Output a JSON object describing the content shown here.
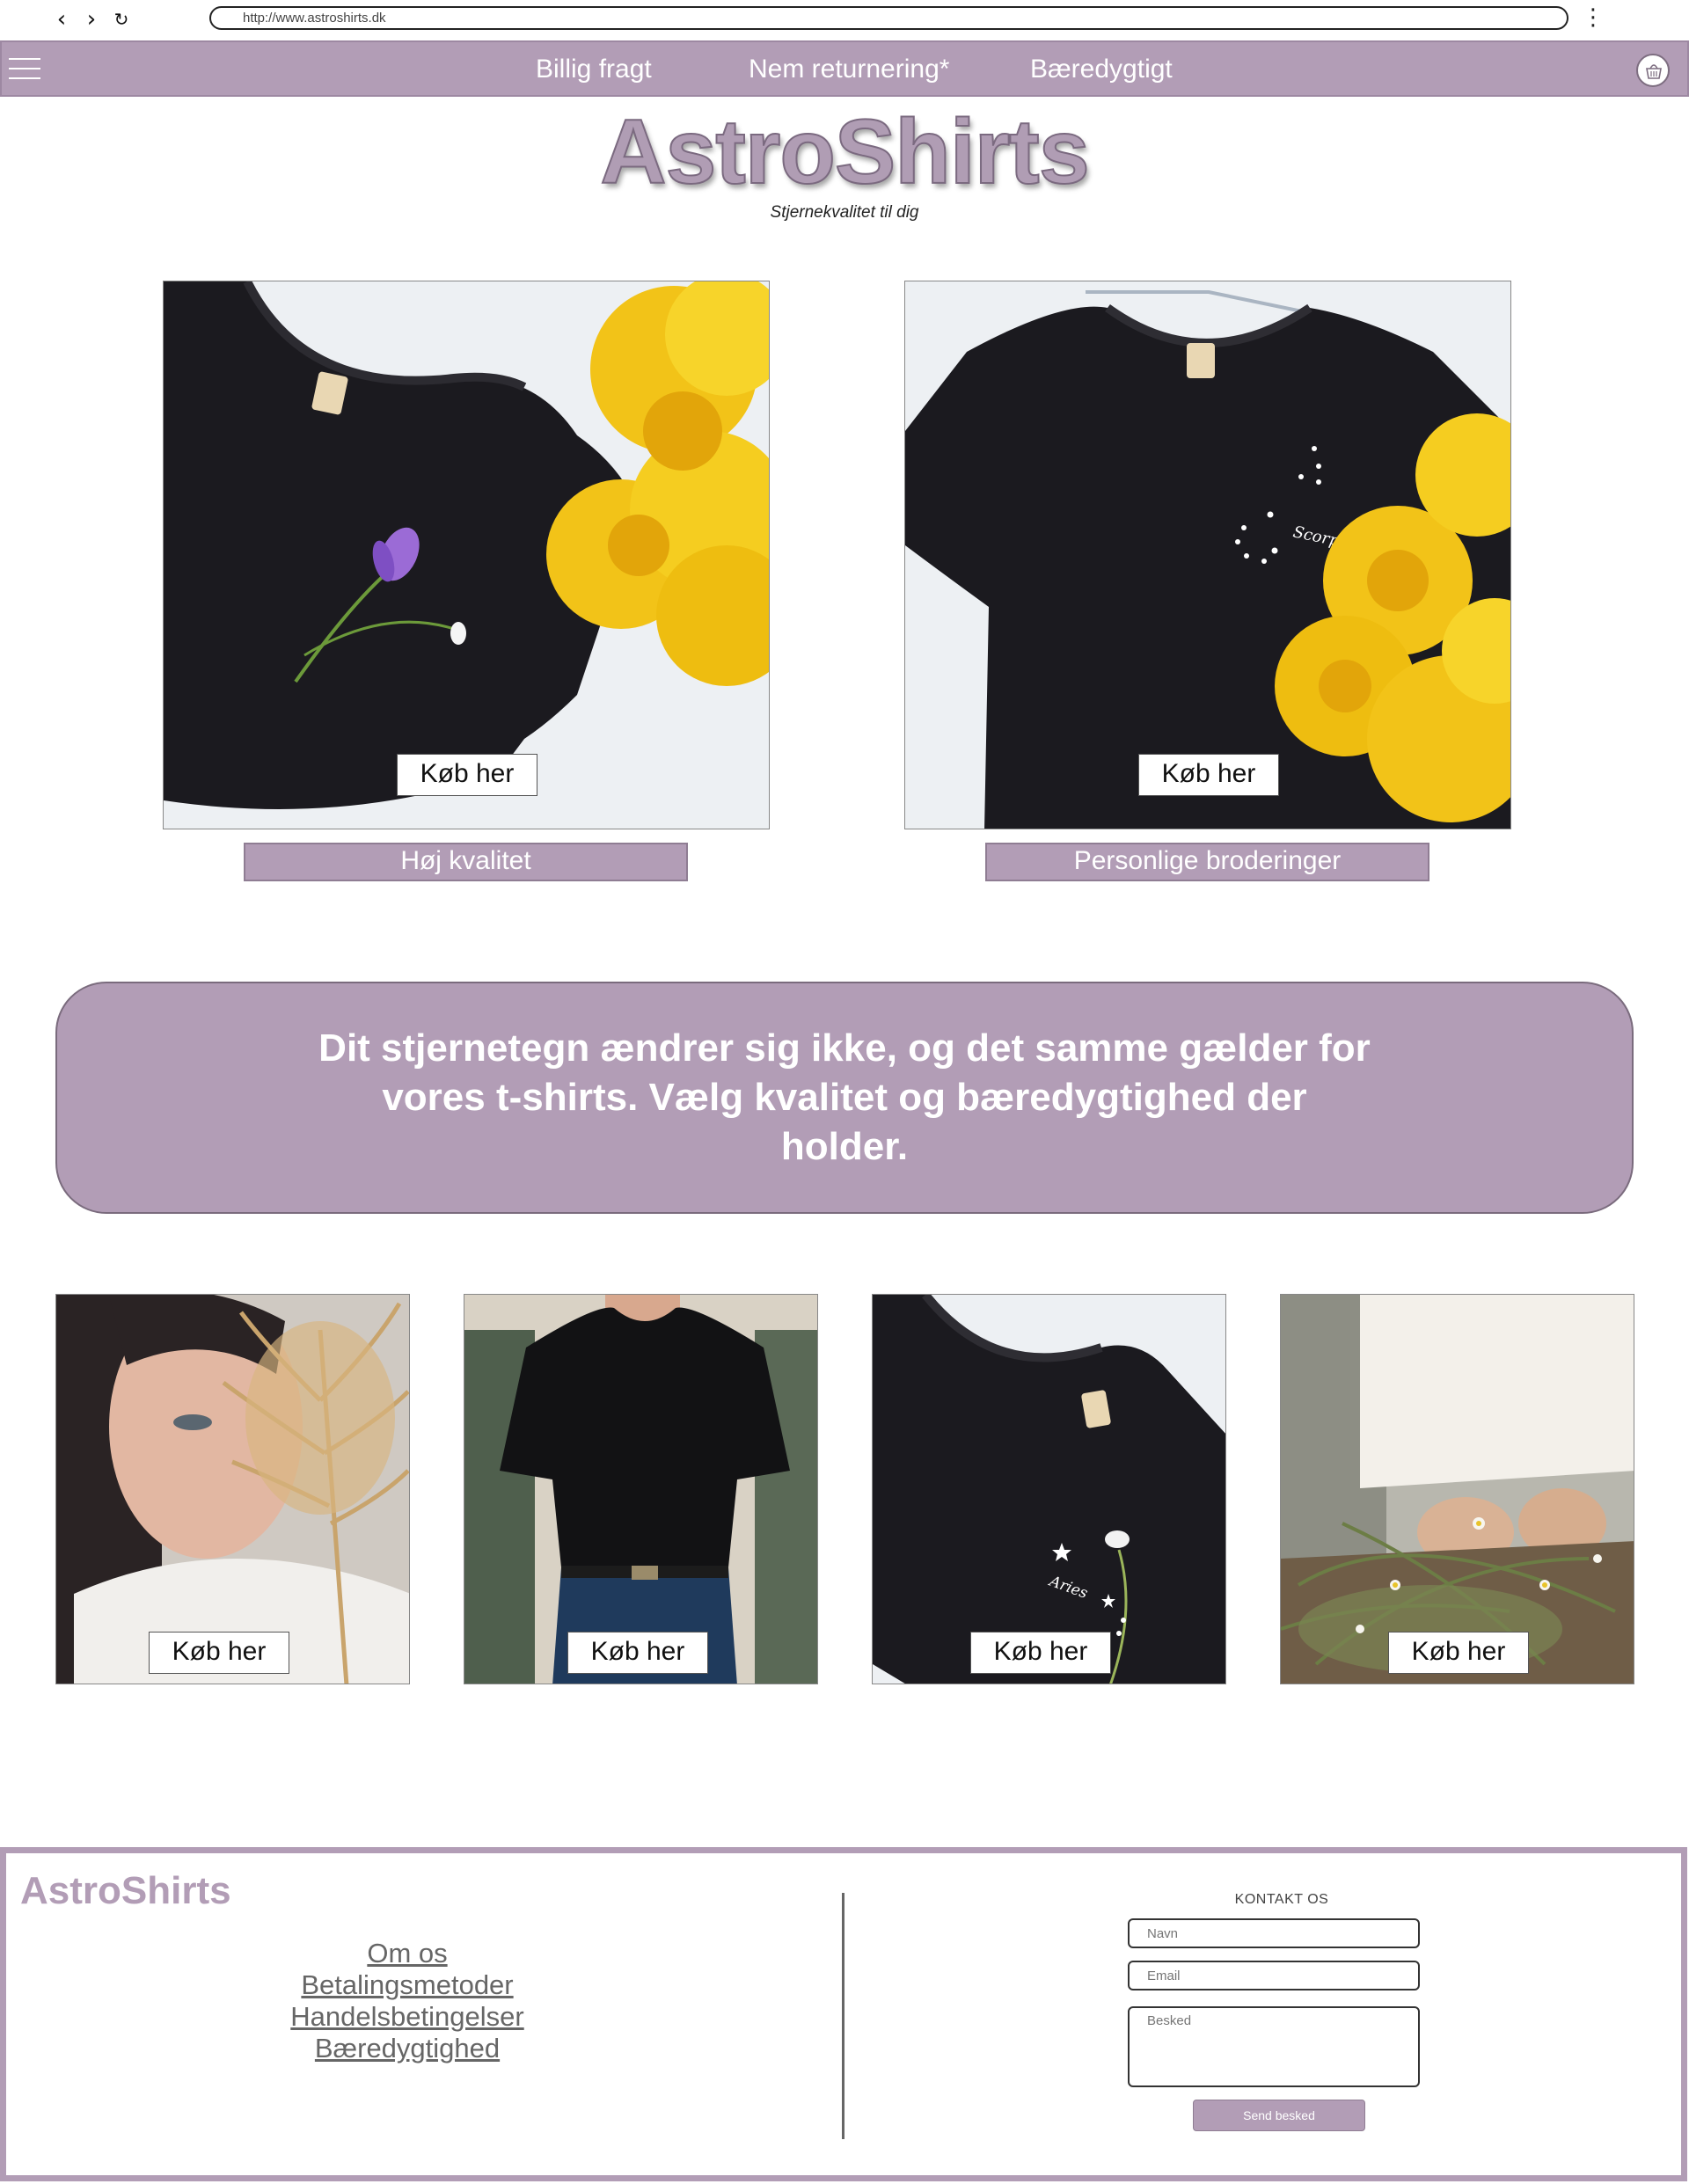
{
  "browser": {
    "url": "http://www.astroshirts.dk"
  },
  "topbar": {
    "links": [
      "Billig fragt",
      "Nem returnering*",
      "Bæredygtigt"
    ]
  },
  "header": {
    "logo": "AstroShirts",
    "tagline": "Stjernekvalitet til dig"
  },
  "featured": [
    {
      "button": "Køb her",
      "caption": "Høj kvalitet"
    },
    {
      "button": "Køb her",
      "caption": "Personlige broderinger"
    }
  ],
  "banner": {
    "text": "Dit stjernetegn ændrer sig ikke, og det samme gælder for vores t-shirts. Vælg kvalitet og bæredygtighed der holder."
  },
  "gallery": [
    {
      "button": "Køb her"
    },
    {
      "button": "Køb her"
    },
    {
      "button": "Køb her"
    },
    {
      "button": "Køb her"
    }
  ],
  "footer": {
    "logo": "AstroShirts",
    "links": [
      "Om os",
      "Betalingsmetoder",
      "Handelsbetingelser",
      "Bæredygtighed"
    ],
    "contact": {
      "title": "KONTAKT OS",
      "name_placeholder": "Navn",
      "email_placeholder": "Email",
      "message_placeholder": "Besked",
      "submit": "Send besked"
    }
  },
  "colors": {
    "brand": "#b29db6",
    "brand_dark": "#7b6a80",
    "flower_yellow": "#f2c318",
    "shirt_black": "#1b1a1f"
  }
}
